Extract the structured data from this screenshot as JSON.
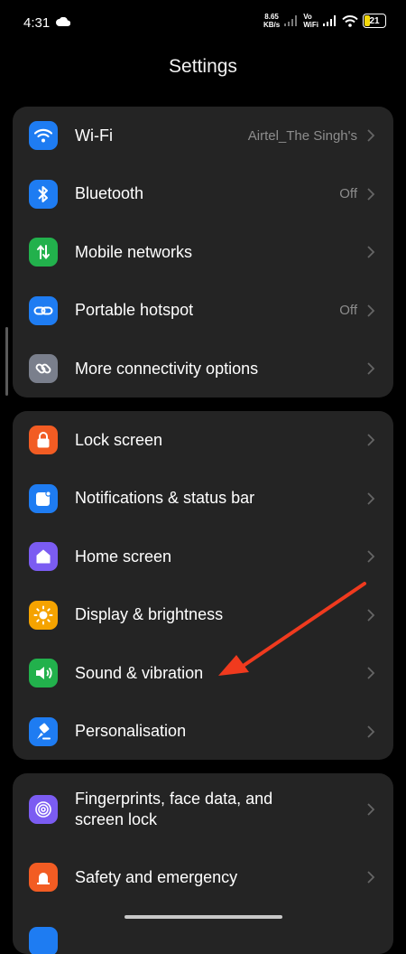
{
  "status_bar": {
    "time": "4:31",
    "net_speed_value": "8.65",
    "net_speed_unit": "KB/s",
    "vo_label": "Vo",
    "wifi_label": "WiFi",
    "battery": "21"
  },
  "page": {
    "title": "Settings"
  },
  "groups": [
    {
      "items": [
        {
          "label": "Wi-Fi",
          "value": "Airtel_The Singh's",
          "icon": "wifi-icon",
          "color": "#1e7cf2"
        },
        {
          "label": "Bluetooth",
          "value": "Off",
          "icon": "bluetooth-icon",
          "color": "#1e7cf2"
        },
        {
          "label": "Mobile networks",
          "value": "",
          "icon": "mobile-data-icon",
          "color": "#22b14c"
        },
        {
          "label": "Portable hotspot",
          "value": "Off",
          "icon": "hotspot-icon",
          "color": "#1e7cf2"
        },
        {
          "label": "More connectivity options",
          "value": "",
          "icon": "link-icon",
          "color": "#7a7f8c"
        }
      ]
    },
    {
      "items": [
        {
          "label": "Lock screen",
          "value": "",
          "icon": "lock-icon",
          "color": "#f25c23"
        },
        {
          "label": "Notifications & status bar",
          "value": "",
          "icon": "notification-icon",
          "color": "#1e7cf2"
        },
        {
          "label": "Home screen",
          "value": "",
          "icon": "home-icon",
          "color": "#7b5cf2"
        },
        {
          "label": "Display & brightness",
          "value": "",
          "icon": "sun-icon",
          "color": "#f5a300"
        },
        {
          "label": "Sound & vibration",
          "value": "",
          "icon": "speaker-icon",
          "color": "#22b14c"
        },
        {
          "label": "Personalisation",
          "value": "",
          "icon": "paint-brush-icon",
          "color": "#1e7cf2"
        }
      ]
    },
    {
      "items": [
        {
          "label": "Fingerprints, face data, and screen lock",
          "value": "",
          "icon": "fingerprint-icon",
          "color": "#7b5cf2"
        },
        {
          "label": "Safety and emergency",
          "value": "",
          "icon": "emergency-icon",
          "color": "#f25c23"
        }
      ]
    }
  ],
  "annotation": {
    "color": "#f03a1e"
  },
  "colors": {
    "background": "#000000",
    "card": "#242424",
    "secondary_text": "#8d8d8d"
  }
}
